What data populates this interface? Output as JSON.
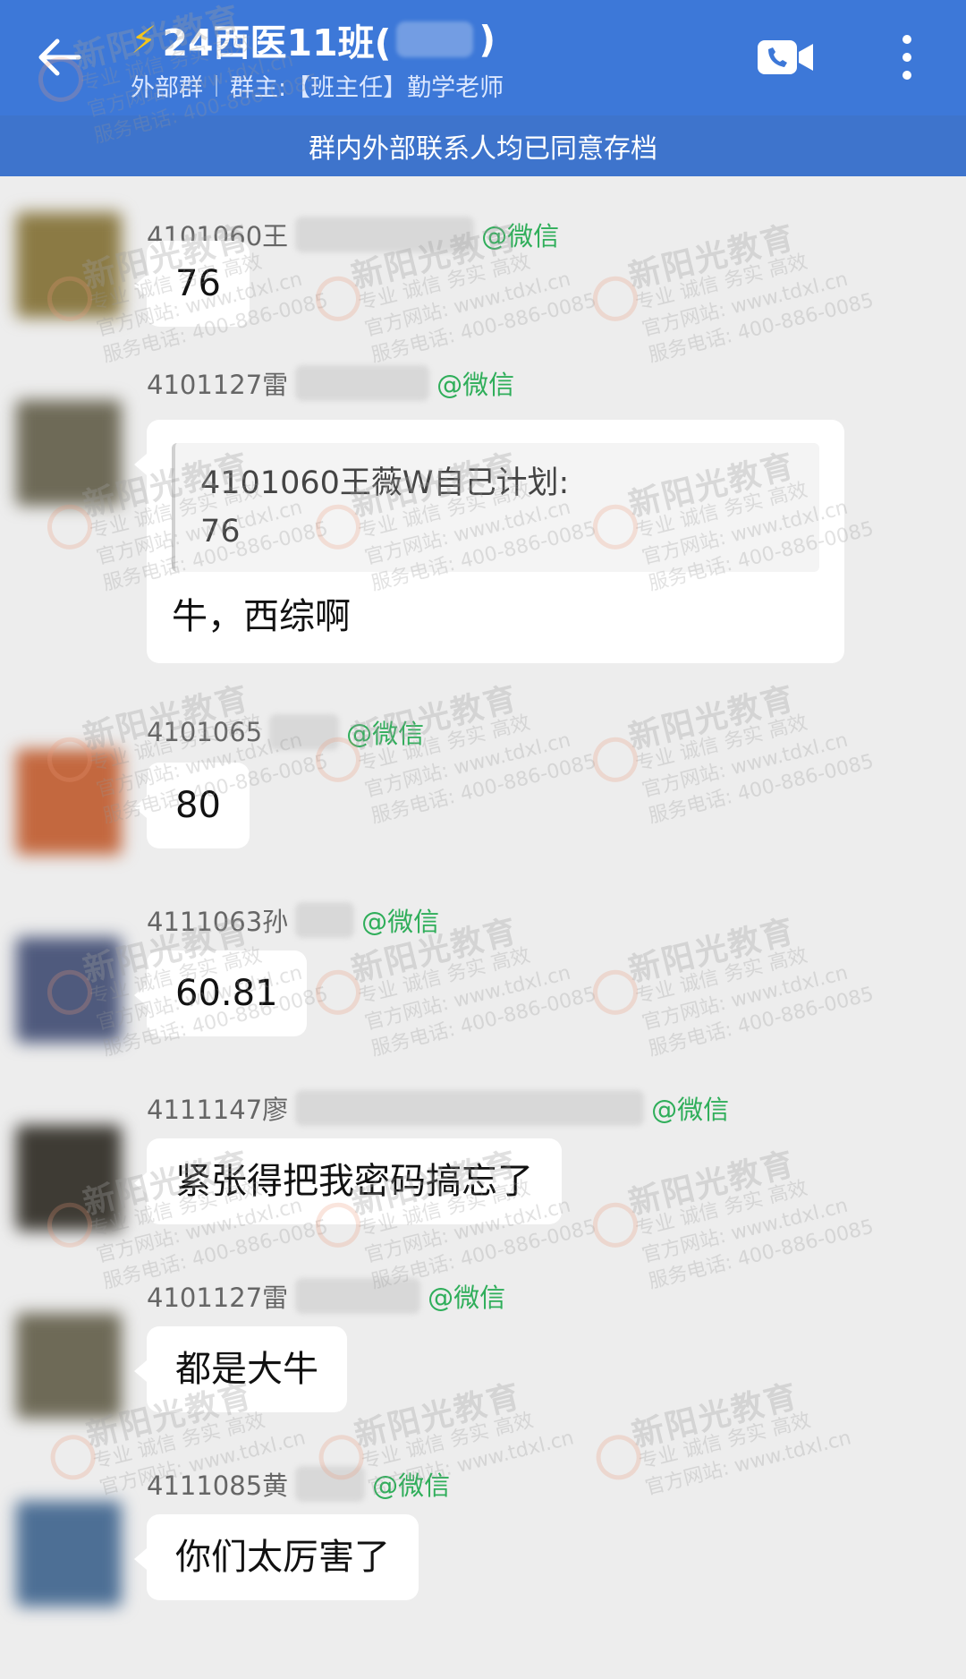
{
  "header": {
    "title_prefix": "24西医11班(",
    "title_suffix": ")",
    "group_type": "外部群",
    "owner": "群主:【班主任】勤学老师"
  },
  "notice": "群内外部联系人均已同意存档",
  "messages": [
    {
      "sender_prefix": "4101060王",
      "tag": "@微信",
      "text": "76",
      "avatar_color": "#8b7a44"
    },
    {
      "sender_prefix": "4101127雷",
      "tag": "@微信",
      "quote_title": "4101060王薇W自己计划:",
      "quote_text": "76",
      "text": "牛，西综啊",
      "avatar_color": "#6e6a57"
    },
    {
      "sender_prefix": "4101065",
      "tag": "@微信",
      "text": "80",
      "avatar_color": "#c3683f"
    },
    {
      "sender_prefix": "4111063孙",
      "tag": "@微信",
      "text": "60.81",
      "avatar_color": "#4f5a7d"
    },
    {
      "sender_prefix": "4111147廖",
      "tag": "@微信",
      "text": "紧张得把我密码搞忘了",
      "avatar_color": "#3e3b34"
    },
    {
      "sender_prefix": "4101127雷",
      "tag": "@微信",
      "text": "都是大牛",
      "avatar_color": "#6e6a57"
    },
    {
      "sender_prefix": "4111085黄",
      "tag": "@微信",
      "text": "你们太厉害了",
      "avatar_color": "#4d6f95"
    }
  ],
  "watermark": {
    "logo": "新阳光教育",
    "slogan": "专业  诚信  务实  高效",
    "site": "官方网站: www.tdxl.cn",
    "phone": "服务电话: 400-886-0085"
  }
}
